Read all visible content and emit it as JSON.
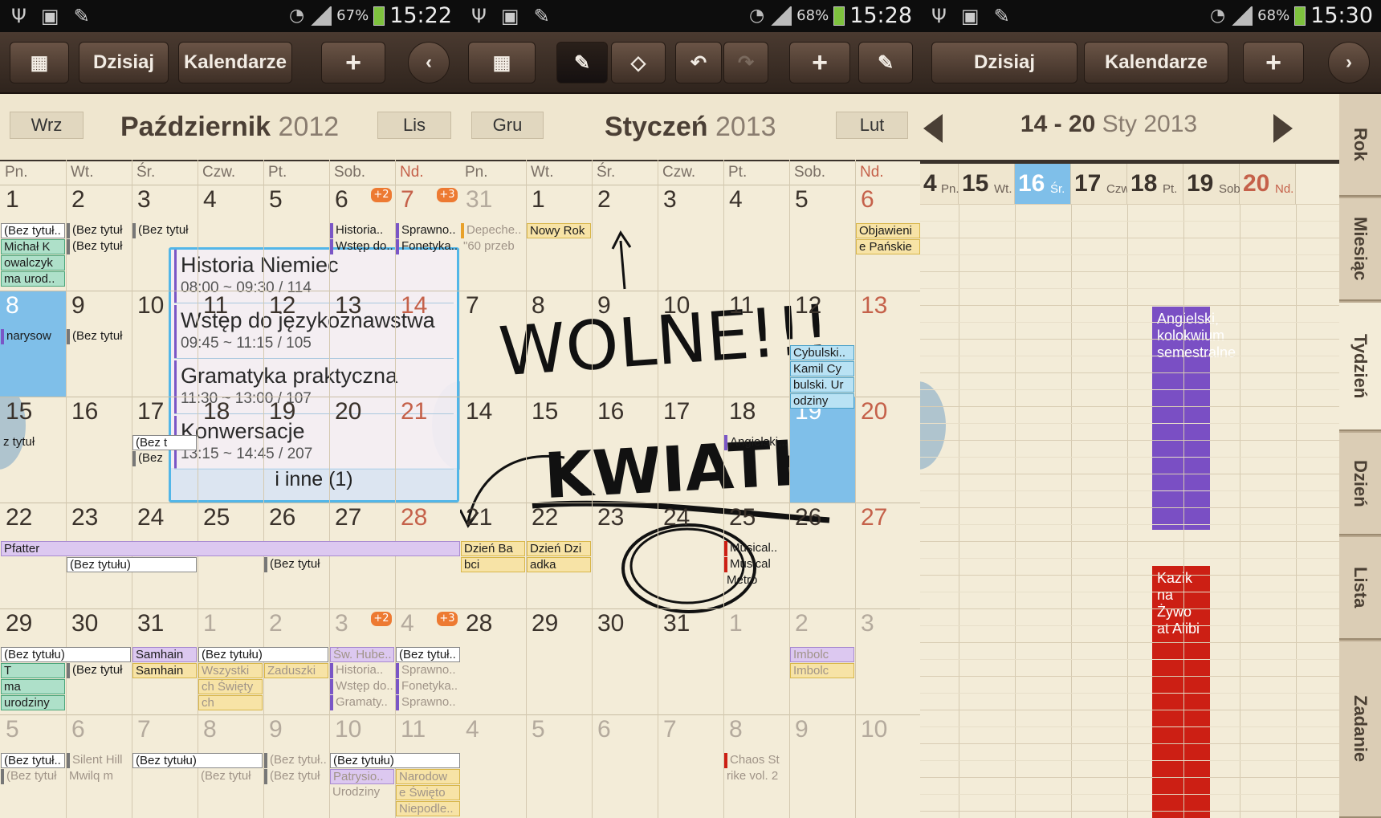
{
  "panel1": {
    "status": {
      "battery": "67%",
      "time": "15:22"
    },
    "toolbar": {
      "today": "Dzisiaj",
      "calendars": "Kalendarze",
      "add": "+"
    },
    "header": {
      "prev": "Wrz",
      "month": "Październik",
      "year": "2012",
      "next": "Lis"
    }
  },
  "panel2": {
    "status": {
      "battery": "68%",
      "time": "15:28"
    },
    "toolbar": {
      "add": "+"
    },
    "header": {
      "prev": "Gru",
      "month": "Styczeń",
      "year": "2013",
      "next": "Lut"
    }
  },
  "panel3": {
    "status": {
      "battery": "68%",
      "time": "15:30"
    },
    "toolbar": {
      "today": "Dzisiaj",
      "calendars": "Kalendarze",
      "add": "+"
    },
    "header": {
      "range": "14 - 20",
      "month": "Sty",
      "year": "2013"
    },
    "days": [
      {
        "n": "4",
        "w": "Pn."
      },
      {
        "n": "15",
        "w": "Wt."
      },
      {
        "n": "16",
        "w": "Śr."
      },
      {
        "n": "17",
        "w": "Czw."
      },
      {
        "n": "18",
        "w": "Pt."
      },
      {
        "n": "19",
        "w": "Sob."
      },
      {
        "n": "20",
        "w": "Nd."
      }
    ],
    "events": [
      "Angielski, kolokwium semestralne",
      "Kazik na Żywo at Alibi"
    ],
    "tabs": [
      "Rok",
      "Miesiąc",
      "Tydzień",
      "Dzień",
      "Lista",
      "Zadanie"
    ]
  },
  "weekdays": [
    "Pn.",
    "Wt.",
    "Śr.",
    "Czw.",
    "Pt.",
    "Sob.",
    "Nd."
  ],
  "popup": {
    "items": [
      {
        "title": "Historia Niemiec",
        "sub": "08:00 ~ 09:30 / 114"
      },
      {
        "title": "Wstęp do językoznawstwa",
        "sub": "09:45 ~ 11:15 / 105"
      },
      {
        "title": "Gramatyka praktyczna",
        "sub": "11:30 ~ 13:00 / 107"
      },
      {
        "title": "Konwersacje",
        "sub": "13:15 ~ 14:45 / 207"
      }
    ],
    "more": "i inne (1)"
  },
  "handwriting": {
    "free": "WOLNE!!!",
    "flowers": "KWIATKI"
  },
  "colors": {
    "today": "#7fbfe9",
    "accent": "#52b6e8",
    "purple": "#7a4fc4",
    "red": "#cc1f14",
    "badge": "#ed7a32"
  }
}
